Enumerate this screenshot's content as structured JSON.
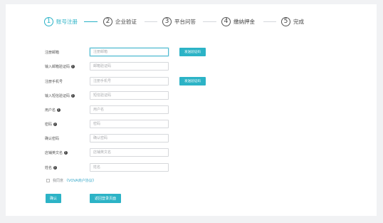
{
  "stepper": {
    "steps": [
      {
        "num": "1",
        "label": "账号注册"
      },
      {
        "num": "2",
        "label": "企业验证"
      },
      {
        "num": "3",
        "label": "平台问答"
      },
      {
        "num": "4",
        "label": "缴纳押金"
      },
      {
        "num": "5",
        "label": "完成"
      }
    ]
  },
  "form": {
    "fields": [
      {
        "label": "注册邮箱",
        "placeholder": "注册邮箱",
        "help": false
      },
      {
        "label": "输入邮箱验证码",
        "placeholder": "邮箱验证码",
        "help": true
      },
      {
        "label": "注册手机号",
        "placeholder": "注册手机号",
        "help": false
      },
      {
        "label": "输入短信验证码",
        "placeholder": "短信验证码",
        "help": true
      },
      {
        "label": "用户名",
        "placeholder": "用户名",
        "help": true
      },
      {
        "label": "密码",
        "placeholder": "密码",
        "help": true
      },
      {
        "label": "确认密码",
        "placeholder": "确认密码",
        "help": false
      },
      {
        "label": "店铺英文名",
        "placeholder": "店铺英文名",
        "help": true
      },
      {
        "label": "姓名",
        "placeholder": "姓名",
        "help": true
      }
    ],
    "help_glyph": "?",
    "send_email_code": "发送验证码",
    "send_sms_code": "发送验证码",
    "agree_text": "我同意",
    "agree_link": "《VOVA商户协议》",
    "confirm_button": "确认",
    "back_button": "返回登录页面"
  },
  "colors": {
    "accent": "#2cb3c6",
    "background": "#f1f2f4"
  }
}
